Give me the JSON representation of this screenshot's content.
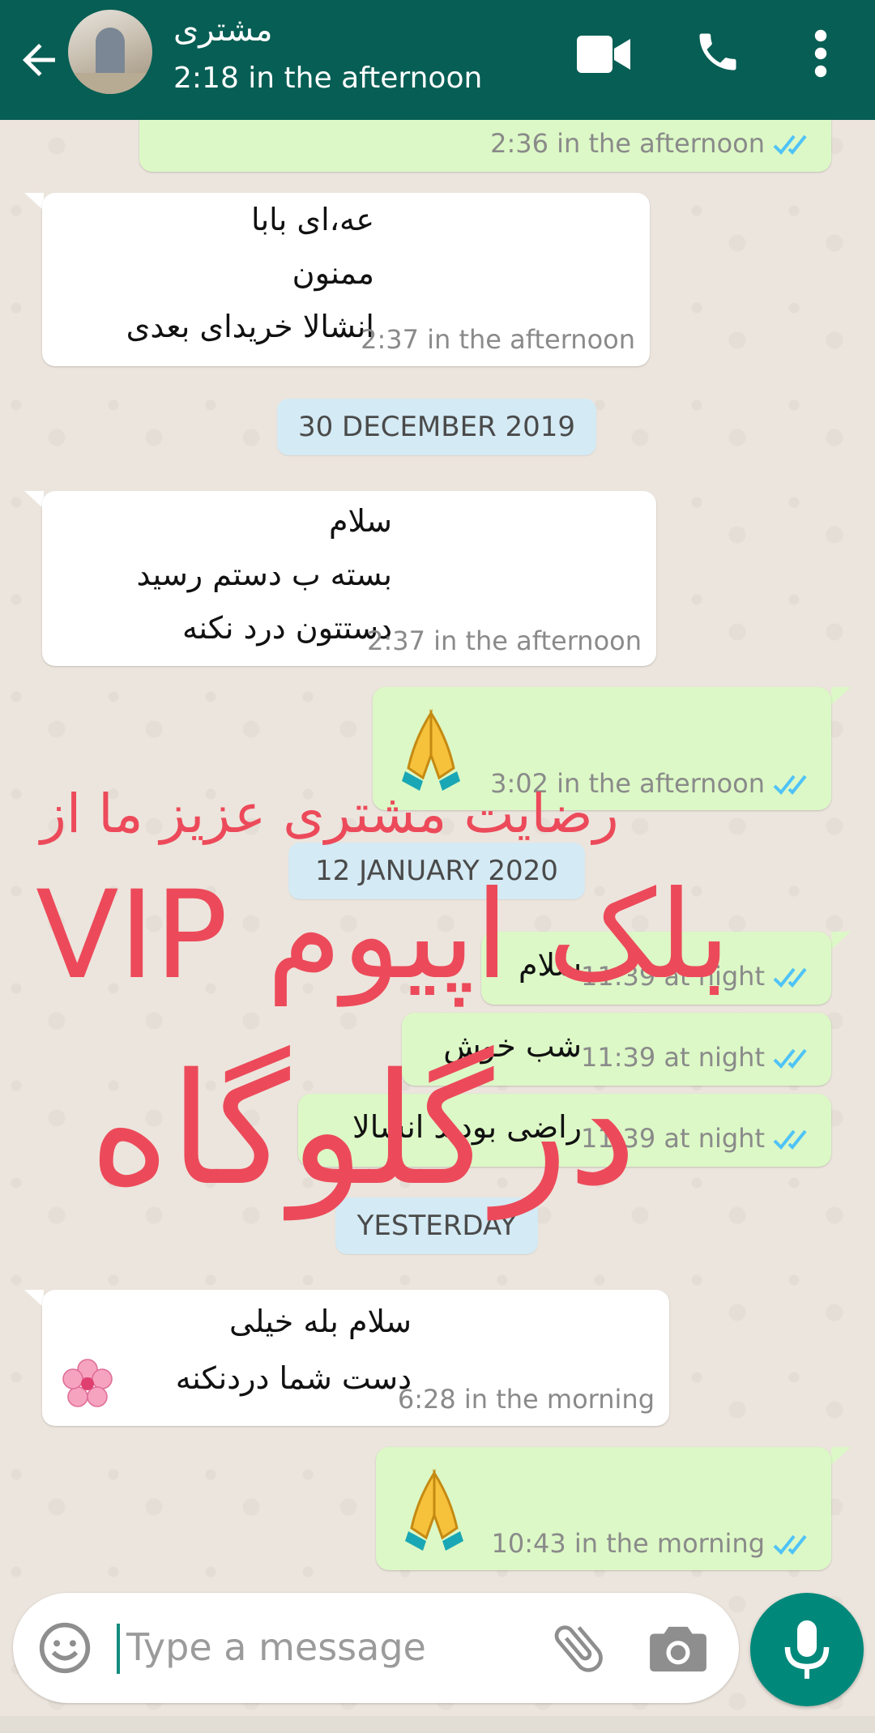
{
  "header": {
    "contact_name": "مشتری",
    "last_seen": "2:18 in the afternoon",
    "colors": {
      "bar": "#075e54",
      "text": "#ffffff"
    },
    "icons": [
      "back-arrow-icon",
      "video-call-icon",
      "phone-icon",
      "more-vert-icon"
    ]
  },
  "messages": [
    {
      "id": "m0",
      "direction": "outgoing",
      "text": "",
      "time": "2:36 in the afternoon",
      "ticks": "read"
    },
    {
      "id": "m1",
      "direction": "incoming",
      "lines": [
        "عه،ای بابا",
        "ممنون",
        "انشالا خریدای بعدی"
      ],
      "time": "2:37 in the afternoon"
    },
    {
      "id": "m2",
      "direction": "incoming",
      "lines": [
        "سلام",
        "بسته ب دستم رسید",
        "دستتون درد نکنه"
      ],
      "time": "2:37 in the afternoon"
    },
    {
      "id": "m3",
      "direction": "outgoing",
      "emoji": "folded-hands",
      "time": "3:02 in the afternoon",
      "ticks": "read"
    },
    {
      "id": "m4",
      "direction": "outgoing",
      "text": "سلام",
      "time": "11:39 at night",
      "ticks": "read"
    },
    {
      "id": "m5",
      "direction": "outgoing",
      "text": "شب خوش",
      "time": "11:39 at night",
      "ticks": "read"
    },
    {
      "id": "m6",
      "direction": "outgoing",
      "text": "راضی بودید انشالا",
      "time": "11:39 at night",
      "ticks": "read"
    },
    {
      "id": "m7",
      "direction": "incoming",
      "lines": [
        "سلام بله خیلی",
        "دست شما دردنکنه"
      ],
      "emoji": "cherry-blossom",
      "time": "6:28 in the morning"
    },
    {
      "id": "m8",
      "direction": "outgoing",
      "emoji": "folded-hands",
      "time": "10:43 in the morning",
      "ticks": "read"
    }
  ],
  "date_separators": {
    "d1": "30 DECEMBER 2019",
    "d2": "12 JANUARY 2020",
    "d3": "YESTERDAY"
  },
  "watermark": {
    "line1": "رضایت مشتری عزیز ما از",
    "line2": "بلک اپیوم VIP",
    "line3": "درگلوگاه",
    "color": "#ec4a5a"
  },
  "input": {
    "placeholder": "Type a message",
    "icons": [
      "emoji-icon",
      "attach-icon",
      "camera-icon",
      "mic-icon"
    ],
    "mic_color": "#00897b"
  },
  "colors": {
    "incoming_bubble": "#ffffff",
    "outgoing_bubble": "#dcf8c6",
    "read_ticks": "#4fc3f7",
    "chat_background": "#ece5dd"
  }
}
